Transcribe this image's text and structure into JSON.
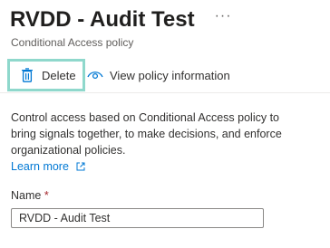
{
  "header": {
    "title": "RVDD - Audit Test",
    "more_label": "···",
    "subtitle": "Conditional Access policy"
  },
  "toolbar": {
    "delete_label": "Delete",
    "delete_icon": "trash-icon",
    "view_label": "View policy information",
    "view_icon": "eye-icon"
  },
  "description": {
    "text": "Control access based on Conditional Access policy to bring signals together, to make decisions, and enforce organizational policies.",
    "learn_more": "Learn more",
    "learn_more_icon": "external-link-icon"
  },
  "name_field": {
    "label": "Name",
    "required_marker": "*",
    "value": "RVDD - Audit Test"
  },
  "colors": {
    "accent": "#0078d4",
    "highlight_border": "#8fd8cc",
    "required": "#a4262c"
  }
}
